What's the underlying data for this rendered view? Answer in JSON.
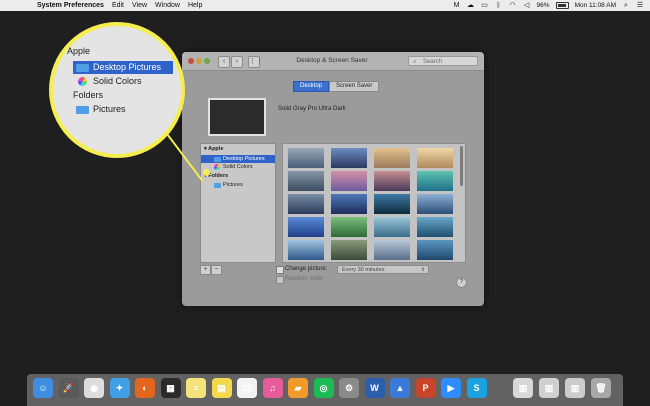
{
  "menubar": {
    "app_name": "System Preferences",
    "menus": [
      "Edit",
      "View",
      "Window",
      "Help"
    ],
    "battery": "96%",
    "clock": "Mon 11:08 AM"
  },
  "window": {
    "title": "Desktop & Screen Saver",
    "search_placeholder": "Search",
    "tabs": [
      {
        "label": "Desktop",
        "active": true
      },
      {
        "label": "Screen Saver",
        "active": false
      }
    ],
    "current_picture_name": "Solid Gray Pro Ultra Dark"
  },
  "sidebar": {
    "groups": [
      {
        "label": "Apple",
        "items": [
          {
            "label": "Desktop Pictures",
            "selected": true,
            "icon": "folder-icon"
          },
          {
            "label": "Solid Colors",
            "selected": false,
            "icon": "color-wheel-icon"
          }
        ]
      },
      {
        "label": "Folders",
        "items": [
          {
            "label": "Pictures",
            "selected": false,
            "icon": "folder-icon"
          }
        ]
      }
    ],
    "add_label": "+",
    "remove_label": "−"
  },
  "wallpapers": [
    {
      "colors": [
        "#4a5f7a",
        "#9aa8b5"
      ]
    },
    {
      "colors": [
        "#2a3a5e",
        "#6d8cc0"
      ]
    },
    {
      "colors": [
        "#9a7a5a",
        "#e3c28e"
      ]
    },
    {
      "colors": [
        "#b08a5e",
        "#f0d7a6"
      ]
    },
    {
      "colors": [
        "#3c4c62",
        "#8698a8"
      ]
    },
    {
      "colors": [
        "#6a5c9c",
        "#d78fa6"
      ]
    },
    {
      "colors": [
        "#4a3a5a",
        "#c59090"
      ]
    },
    {
      "colors": [
        "#1f6f8a",
        "#5cc4b0"
      ]
    },
    {
      "colors": [
        "#2b3a58",
        "#7a8ea8"
      ]
    },
    {
      "colors": [
        "#1d2e5c",
        "#4e78b8"
      ]
    },
    {
      "colors": [
        "#0e2a3e",
        "#3e7aa6"
      ]
    },
    {
      "colors": [
        "#2a4e78",
        "#8fb1d4"
      ]
    },
    {
      "colors": [
        "#1f3f8a",
        "#5a8ad6"
      ]
    },
    {
      "colors": [
        "#2e6a3a",
        "#7cc07a"
      ]
    },
    {
      "colors": [
        "#3a6e8a",
        "#9cc6d8"
      ]
    },
    {
      "colors": [
        "#1e4e72",
        "#6aa8c8"
      ]
    },
    {
      "colors": [
        "#2e5a8a",
        "#a3c4e0"
      ]
    },
    {
      "colors": [
        "#3a4a3a",
        "#8a9a7a"
      ]
    },
    {
      "colors": [
        "#5a6e8a",
        "#b8c8d8"
      ]
    },
    {
      "colors": [
        "#20486e",
        "#5a96c0"
      ]
    }
  ],
  "options": {
    "change_picture_label": "Change picture:",
    "interval_value": "Every 30 minutes",
    "random_order_label": "Random order",
    "help_label": "?"
  },
  "magnifier": {
    "apple_label": "Apple",
    "selected_item": "Desktop Pictures",
    "item2": "Solid Colors",
    "folders_label": "Folders",
    "folder_item": "Pictures",
    "highlight_color": "#f5ee4e"
  },
  "dock": {
    "apps": [
      {
        "name": "finder-icon",
        "color": "#3e8de0",
        "glyph": "☺"
      },
      {
        "name": "launchpad-icon",
        "color": "#5a5a5a",
        "glyph": "🚀"
      },
      {
        "name": "chrome-icon",
        "color": "#dddddd",
        "glyph": "◉"
      },
      {
        "name": "safari-icon",
        "color": "#3fa0e8",
        "glyph": "✦"
      },
      {
        "name": "firefox-icon",
        "color": "#e2661e",
        "glyph": "◐"
      },
      {
        "name": "activity-monitor-icon",
        "color": "#2a2a2a",
        "glyph": "▦"
      },
      {
        "name": "notes-icon",
        "color": "#f5e27a",
        "glyph": "≡"
      },
      {
        "name": "stickies-icon",
        "color": "#f2d84a",
        "glyph": "▤"
      },
      {
        "name": "calendar-icon",
        "color": "#f3f3f3",
        "glyph": "28"
      },
      {
        "name": "itunes-icon",
        "color": "#e85a9a",
        "glyph": "♫"
      },
      {
        "name": "ibooks-icon",
        "color": "#f09a2a",
        "glyph": "▰"
      },
      {
        "name": "spotify-icon",
        "color": "#1db954",
        "glyph": "◎"
      },
      {
        "name": "system-preferences-icon",
        "color": "#8a8a8a",
        "glyph": "⚙"
      },
      {
        "name": "word-icon",
        "color": "#2b5fad",
        "glyph": "W"
      },
      {
        "name": "keynote-icon",
        "color": "#3a7ad8",
        "glyph": "▲"
      },
      {
        "name": "powerpoint-icon",
        "color": "#c8452a",
        "glyph": "P"
      },
      {
        "name": "zoom-icon",
        "color": "#2d8cff",
        "glyph": "▶"
      },
      {
        "name": "skype-icon",
        "color": "#1aa3e0",
        "glyph": "S"
      },
      {
        "name": "document-stack-icon",
        "color": "#d8d8d8",
        "glyph": "▥"
      },
      {
        "name": "document-stack-icon-2",
        "color": "#d0d0d0",
        "glyph": "▥"
      },
      {
        "name": "document-stack-icon-3",
        "color": "#cccccc",
        "glyph": "▥"
      },
      {
        "name": "trash-icon",
        "color": "#a8a8a8",
        "glyph": "🗑"
      }
    ]
  }
}
